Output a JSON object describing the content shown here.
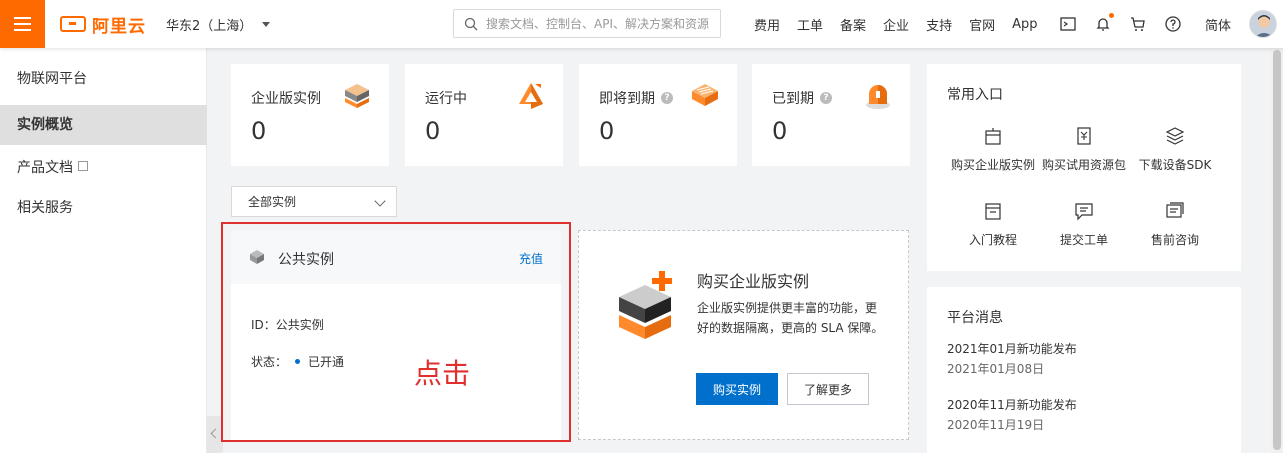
{
  "topbar": {
    "logo_text": "阿里云",
    "region": "华东2（上海）",
    "search_placeholder": "搜索文档、控制台、API、解决方案和资源",
    "nav": [
      "费用",
      "工单",
      "备案",
      "企业",
      "支持",
      "官网",
      "App"
    ],
    "icons": [
      "terminal-icon",
      "bell-icon",
      "cart-icon",
      "help-icon"
    ],
    "language": "简体",
    "brand_color": "#ff6a00"
  },
  "sidebar": {
    "title": "物联网平台",
    "items": [
      {
        "label": "实例概览",
        "active": true
      },
      {
        "label": "产品文档",
        "external": true
      },
      {
        "label": "相关服务"
      }
    ]
  },
  "stats": [
    {
      "label": "企业版实例",
      "value": "0",
      "icon": "enterprise-instance-icon"
    },
    {
      "label": "运行中",
      "value": "0",
      "icon": "running-icon"
    },
    {
      "label": "即将到期",
      "value": "0",
      "icon": "expiring-icon",
      "help": true
    },
    {
      "label": "已到期",
      "value": "0",
      "icon": "expired-icon",
      "help": true
    }
  ],
  "filter": {
    "selected": "全部实例"
  },
  "instance": {
    "title": "公共实例",
    "charge_link": "充值",
    "id_label": "ID：",
    "id_value": "公共实例",
    "status_label": "状态：",
    "status_value": "已开通",
    "status_color": "#0070cc"
  },
  "annotation": {
    "label": "点击",
    "color": "#e0302e"
  },
  "buy": {
    "title": "购买企业版实例",
    "description": "企业版实例提供更丰富的功能，更好的数据隔离，更高的 SLA 保障。",
    "primary_button": "购买实例",
    "secondary_button": "了解更多",
    "primary_color": "#0070cc"
  },
  "quick_entry": {
    "title": "常用入口",
    "items": [
      {
        "label": "购买企业版实例",
        "icon": "buy-instance-icon"
      },
      {
        "label": "购买试用资源包",
        "icon": "buy-package-icon"
      },
      {
        "label": "下载设备SDK",
        "icon": "download-sdk-icon"
      },
      {
        "label": "入门教程",
        "icon": "tutorial-icon"
      },
      {
        "label": "提交工单",
        "icon": "ticket-icon"
      },
      {
        "label": "售前咨询",
        "icon": "consult-icon"
      }
    ]
  },
  "news": {
    "title": "平台消息",
    "items": [
      {
        "title": "2021年01月新功能发布",
        "date": "2021年01月08日"
      },
      {
        "title": "2020年11月新功能发布",
        "date": "2020年11月19日"
      }
    ]
  }
}
